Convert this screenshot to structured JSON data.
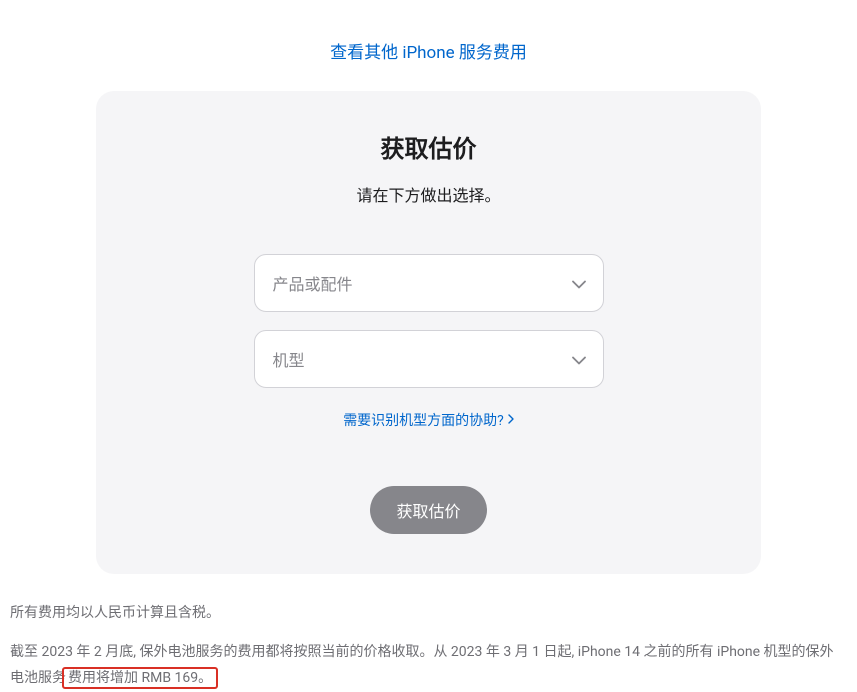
{
  "topLink": {
    "label": "查看其他 iPhone 服务费用"
  },
  "card": {
    "title": "获取估价",
    "subtitle": "请在下方做出选择。",
    "select1": {
      "placeholder": "产品或配件"
    },
    "select2": {
      "placeholder": "机型"
    },
    "helpLink": "需要识别机型方面的协助?",
    "submitLabel": "获取估价"
  },
  "footer": {
    "line1": "所有费用均以人民币计算且含税。",
    "line2_part1": "截至 2023 年 2 月底, 保外电池服务的费用都将按照当前的价格收取。从 2023 年 3 月 1 日起, iPhone 14 之前的所有 iPhone 机型的保外电池服务",
    "line2_highlight": "费用将增加 RMB 169。"
  }
}
